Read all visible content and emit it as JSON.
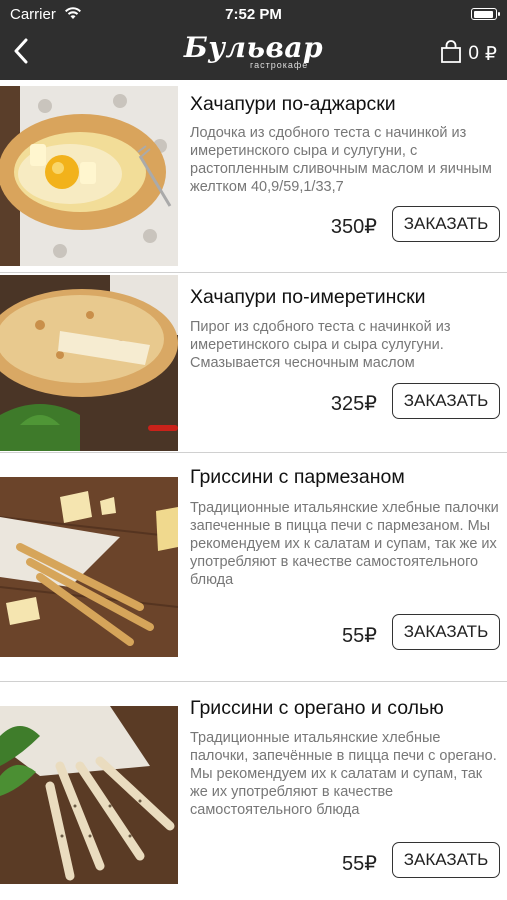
{
  "status_bar": {
    "carrier": "Carrier",
    "time": "7:52 PM",
    "battery_level": 0.95
  },
  "nav": {
    "logo_text": "Бульвар",
    "logo_subtitle": "гастрокафе",
    "cart_count": "0",
    "cart_currency": "₽",
    "back_icon": "chevron-left-icon",
    "cart_icon": "shopping-bag-icon"
  },
  "products": [
    {
      "title": "Хачапури по-аджарски",
      "description": "Лодочка из сдобного теста с начинкой из имеретинского сыра и сулугуни, с растопленным сливочным маслом и яичным желтком 40,9/59,1/33,7",
      "price": "350₽",
      "order_label": "ЗАКАЗАТЬ"
    },
    {
      "title": "Хачапури по-имеретински",
      "description": "Пирог из сдобного теста с начинкой из имеретинского сыра и сыра сулугуни. Смазывается чесночным маслом",
      "price": "325₽",
      "order_label": "ЗАКАЗАТЬ"
    },
    {
      "title": "Гриссини с пармезаном",
      "description": "Традиционные итальянские хлебные палочки запеченные в пицца печи с пармезаном. Мы рекомендуем их к салатам и супам, так же их употребляют в качестве самостоятельного блюда",
      "price": "55₽",
      "order_label": "ЗАКАЗАТЬ"
    },
    {
      "title": "Гриссини с орегано и солью",
      "description": "Традиционные итальянские хлебные палочки, запечённые в пицца печи с орегано. Мы рекомендуем их к салатам и супам, так же их употребляют в качестве самостоятельного блюда",
      "price": "55₽",
      "order_label": "ЗАКАЗАТЬ"
    }
  ],
  "colors": {
    "header_bg": "#2f2f2f",
    "divider": "#d0d0d0",
    "description_text": "#777777"
  }
}
